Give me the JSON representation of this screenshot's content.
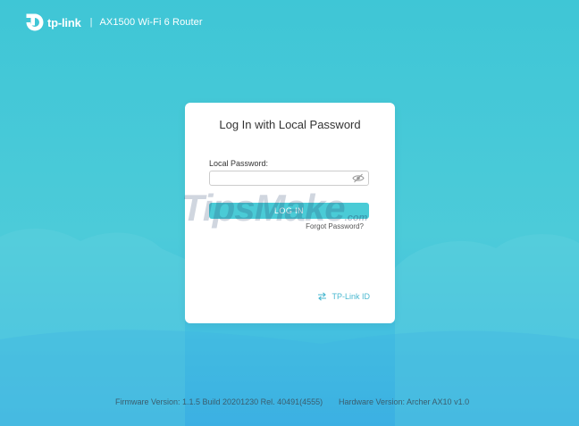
{
  "header": {
    "brand": "tp-link",
    "separator": "|",
    "model": "AX1500 Wi-Fi 6 Router"
  },
  "login": {
    "title": "Log In with Local Password",
    "password_label": "Local Password:",
    "password_value": "",
    "password_placeholder": "",
    "login_button": "LOG IN",
    "forgot_link": "Forgot Password?",
    "tplink_id_link": "TP-Link ID"
  },
  "watermark": {
    "main": "TipsMake",
    "suffix": ".com"
  },
  "footer": {
    "firmware": "Firmware Version: 1.1.5 Build 20201230 Rel. 40491(4555)",
    "hardware": "Hardware Version: Archer AX10 v1.0"
  },
  "icons": {
    "logo": "tp-link-logo-icon",
    "eye": "eye-slash-icon",
    "tplink_id": "swap-arrows-icon"
  },
  "colors": {
    "background": "#45c7d8",
    "accent": "#4acbd6",
    "link": "#4ab8d0",
    "card": "#ffffff"
  }
}
